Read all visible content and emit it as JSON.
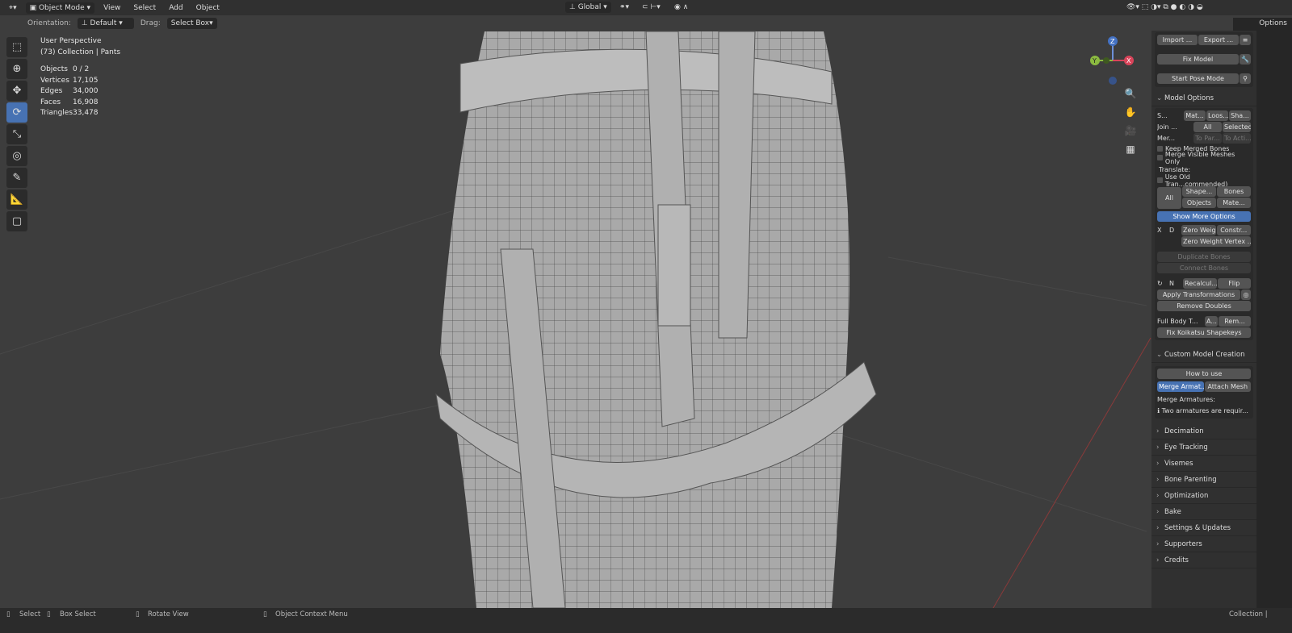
{
  "header": {
    "editor_icon": "viewport-icon",
    "mode": "Object Mode",
    "menus": [
      "View",
      "Select",
      "Add",
      "Object"
    ],
    "transform_orientation": "Global"
  },
  "toolsettings": {
    "orientation_label": "Orientation:",
    "orientation_value": "Default",
    "drag_label": "Drag:",
    "drag_value": "Select Box"
  },
  "overlay": {
    "view_name": "User Perspective",
    "collection": "(73) Collection | Pants",
    "stats": [
      {
        "k": "Objects",
        "v": "0 / 2"
      },
      {
        "k": "Vertices",
        "v": "17,105"
      },
      {
        "k": "Edges",
        "v": "34,000"
      },
      {
        "k": "Faces",
        "v": "16,908"
      },
      {
        "k": "Triangles",
        "v": "33,478"
      }
    ]
  },
  "gizmo": {
    "z": "Z",
    "y": "Y",
    "x": "X"
  },
  "sidebar": {
    "options": "Options",
    "import": "Import ...",
    "export": "Export ...",
    "fix_model": "Fix Model",
    "start_pose": "Start Pose Mode",
    "model_options": "Model Options",
    "separate": "S...",
    "sep_btns": [
      "Mat...",
      "Loos...",
      "Sha..."
    ],
    "join": "Join ...",
    "join_btns": [
      "All",
      "Selected"
    ],
    "merge": "Mer...",
    "merge_btns": [
      "To Par...",
      "To Acti..."
    ],
    "keep_merged": "Keep Merged Bones",
    "merge_visible": "Merge Visible Meshes Only",
    "translate": "Translate:",
    "use_old": "Use Old Tran...commended)",
    "all": "All",
    "tr_btns": [
      "Shape...",
      "Bones",
      "Objects",
      "Mate..."
    ],
    "show_more": "Show More Options",
    "x": "X",
    "d": "D",
    "zero_weig": "Zero Weig...",
    "constr": "Constr...",
    "zero_vertex": "Zero Weight Vertex ...",
    "dup_bones": "Duplicate Bones",
    "conn_bones": "Connect Bones",
    "n": "N",
    "recalc": "Recalcul...",
    "flip": "Flip",
    "apply": "Apply Transformations",
    "remove_doubles": "Remove Doubles",
    "full_body": "Full Body T...",
    "a": "A...",
    "rem": "Rem...",
    "fix_koikatsu": "Fix Koikatsu Shapekeys",
    "custom_model": "Custom Model Creation",
    "how_to": "How to use",
    "merge_arm": "Merge Armat...",
    "attach_mesh": "Attach Mesh",
    "merge_armatures": "Merge Armatures:",
    "two_arm": "Two armatures are requir...",
    "panels": [
      "Decimation",
      "Eye Tracking",
      "Visemes",
      "Bone Parenting",
      "Optimization",
      "Bake",
      "Settings & Updates",
      "Supporters",
      "Credits"
    ]
  },
  "status": {
    "select": "Select",
    "box_select": "Box Select",
    "rotate": "Rotate View",
    "context": "Object Context Menu",
    "right": "Collection |"
  }
}
